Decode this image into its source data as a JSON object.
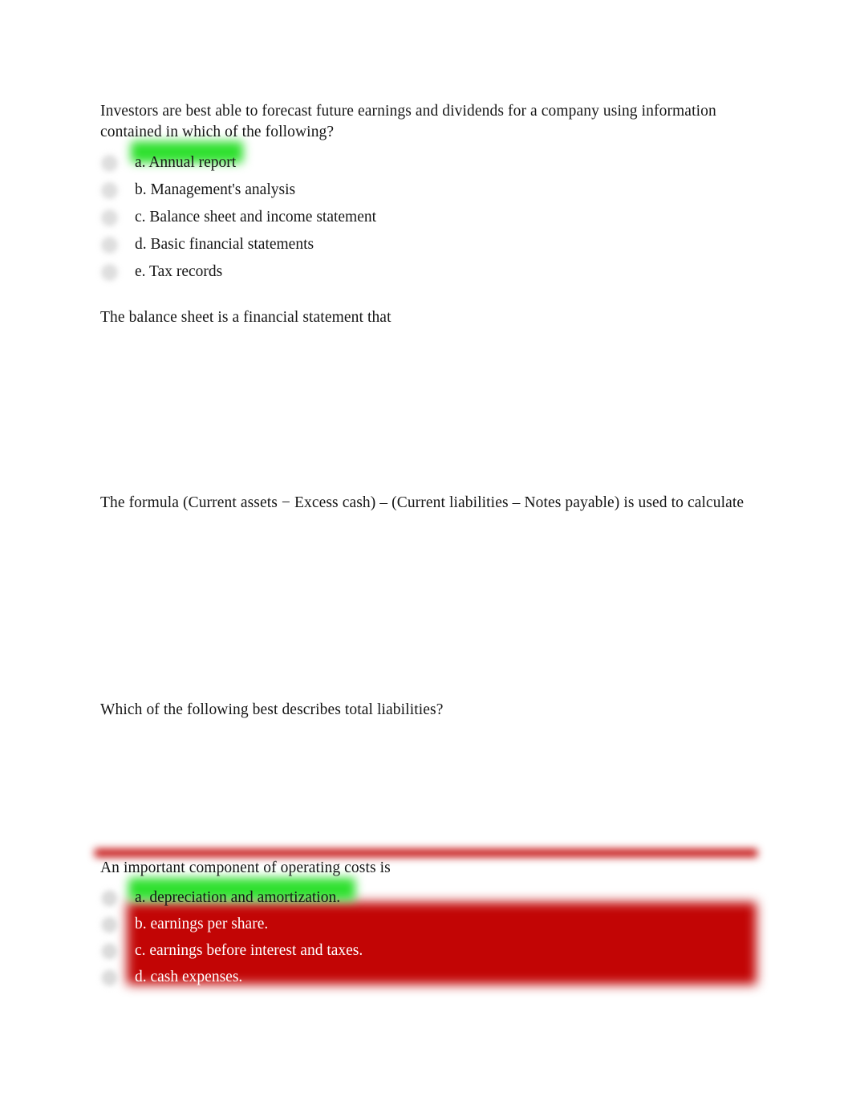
{
  "document": {
    "type": "quiz-worksheet",
    "page_background": "#ffffff",
    "body_text_color": "#161616"
  },
  "colors": {
    "green_highlight": "#2fe02f",
    "red_highlight": "#c20505",
    "radio_fill": "#d9d9d9",
    "white_text": "#ffffff"
  },
  "questions": [
    {
      "id": "q1",
      "stem": "Investors are best able to forecast future earnings and dividends for a company using information contained in which of the following?",
      "options": [
        {
          "label": "a. Annual report",
          "highlight": "green"
        },
        {
          "label": "b. Management's analysis",
          "highlight": "none"
        },
        {
          "label": "c. Balance sheet and income statement",
          "highlight": "none"
        },
        {
          "label": "d. Basic financial statements",
          "highlight": "none"
        },
        {
          "label": "e. Tax records",
          "highlight": "none"
        }
      ]
    },
    {
      "id": "q2",
      "stem": "The balance sheet is a financial statement that",
      "options": []
    },
    {
      "id": "q3",
      "stem": "The formula (Current assets − Excess cash) – (Current liabilities – Notes payable) is used to calculate",
      "options": []
    },
    {
      "id": "q4",
      "stem": "Which of the following best describes total liabilities?",
      "options": []
    },
    {
      "id": "q5",
      "stem": "An important component of operating costs is",
      "options": [
        {
          "label": "a. depreciation and amortization.",
          "highlight": "green"
        },
        {
          "label": "b. earnings per share.",
          "highlight": "red"
        },
        {
          "label": "c. earnings before interest and taxes.",
          "highlight": "red"
        },
        {
          "label": "d. cash expenses.",
          "highlight": "red"
        }
      ]
    }
  ]
}
